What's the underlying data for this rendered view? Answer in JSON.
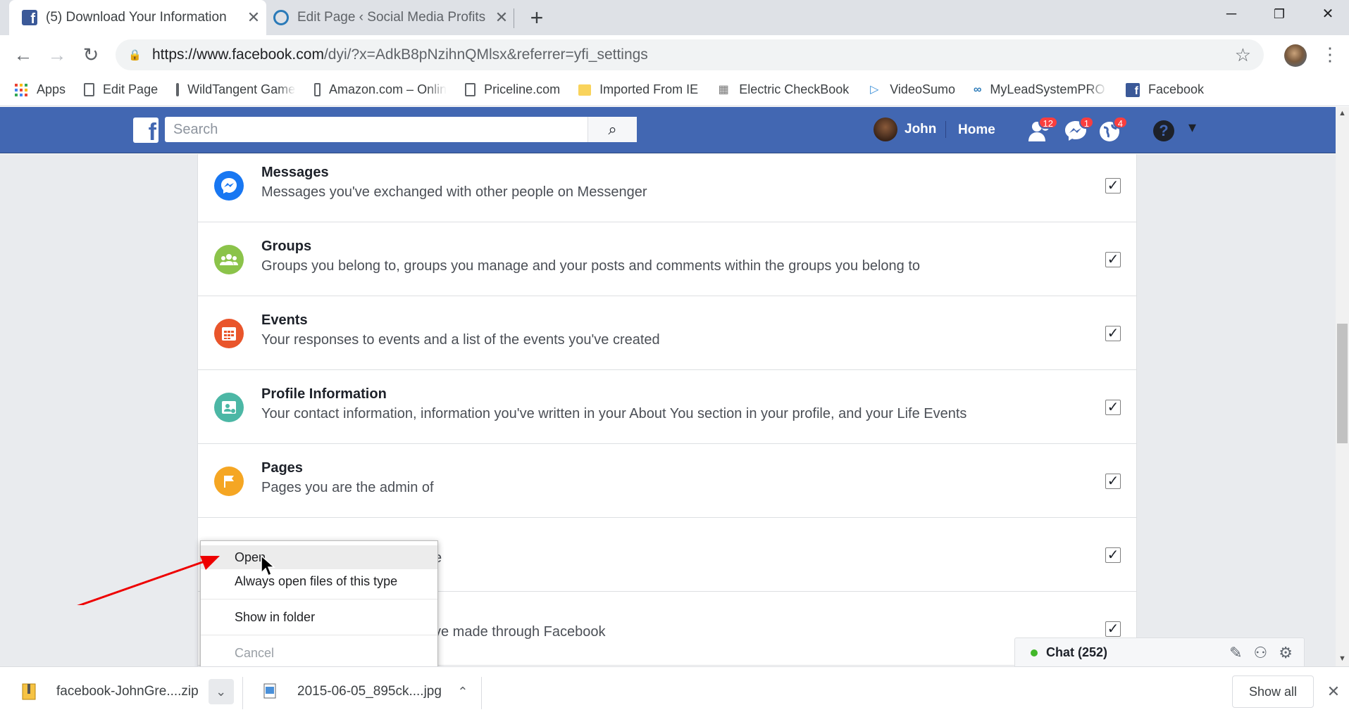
{
  "browser": {
    "tabs": [
      {
        "title": "(5) Download Your Information",
        "active": true
      },
      {
        "title": "Edit Page ‹ Social Media Profits –",
        "active": false
      }
    ],
    "url": {
      "host": "https://www.facebook.com",
      "path": "/dyi/?x=AdkB8pNzihnQMlsx&referrer=yfi_settings"
    },
    "bookmarks": [
      {
        "label": "Apps",
        "icon": "apps-grid-icon"
      },
      {
        "label": "Edit Page",
        "icon": "page-icon"
      },
      {
        "label": "WildTangent Games",
        "icon": "page-icon"
      },
      {
        "label": "Amazon.com – Onlin",
        "icon": "page-icon"
      },
      {
        "label": "Priceline.com",
        "icon": "page-icon"
      },
      {
        "label": "Imported From IE",
        "icon": "folder-icon"
      },
      {
        "label": "Electric CheckBook",
        "icon": "checkbook-icon"
      },
      {
        "label": "VideoSumo",
        "icon": "play-icon"
      },
      {
        "label": "MyLeadSystemPRO M",
        "icon": "mlsp-icon"
      },
      {
        "label": "Facebook",
        "icon": "facebook-icon"
      }
    ]
  },
  "facebook": {
    "search_placeholder": "Search",
    "user_name": "John",
    "home_label": "Home",
    "notifications": {
      "friend_requests": "12",
      "messages": "1",
      "alerts": "4"
    },
    "brand_color": "#4267b2"
  },
  "categories": [
    {
      "title": "Messages",
      "description": "Messages you've exchanged with other people on Messenger",
      "icon": "messenger-icon",
      "color": "#1877f2",
      "checked": true
    },
    {
      "title": "Groups",
      "description": "Groups you belong to, groups you manage and your posts and comments within the groups you belong to",
      "icon": "groups-icon",
      "color": "#8bc34a",
      "checked": true
    },
    {
      "title": "Events",
      "description": "Your responses to events and a list of the events you've created",
      "icon": "calendar-icon",
      "color": "#e9552b",
      "checked": true
    },
    {
      "title": "Profile Information",
      "description": "Your contact information, information you've written in your About You section in your profile, and your Life Events",
      "icon": "profile-icon",
      "color": "#4cb7a5",
      "checked": true
    },
    {
      "title": "Pages",
      "description": "Pages you are the admin of",
      "icon": "flag-icon",
      "color": "#f5a623",
      "checked": true
    },
    {
      "title": "",
      "description": "e",
      "icon": "",
      "color": "",
      "checked": true
    },
    {
      "title": "",
      "description": "ve made through Facebook",
      "icon": "",
      "color": "",
      "checked": true
    }
  ],
  "chat": {
    "label": "Chat (252)"
  },
  "context_menu": {
    "items": [
      "Open",
      "Always open files of this type",
      "Show in folder",
      "Cancel"
    ]
  },
  "downloads": [
    {
      "filename": "facebook-JohnGre....zip"
    },
    {
      "filename": "2015-06-05_895ck....jpg"
    }
  ],
  "download_bar": {
    "show_all": "Show all"
  }
}
